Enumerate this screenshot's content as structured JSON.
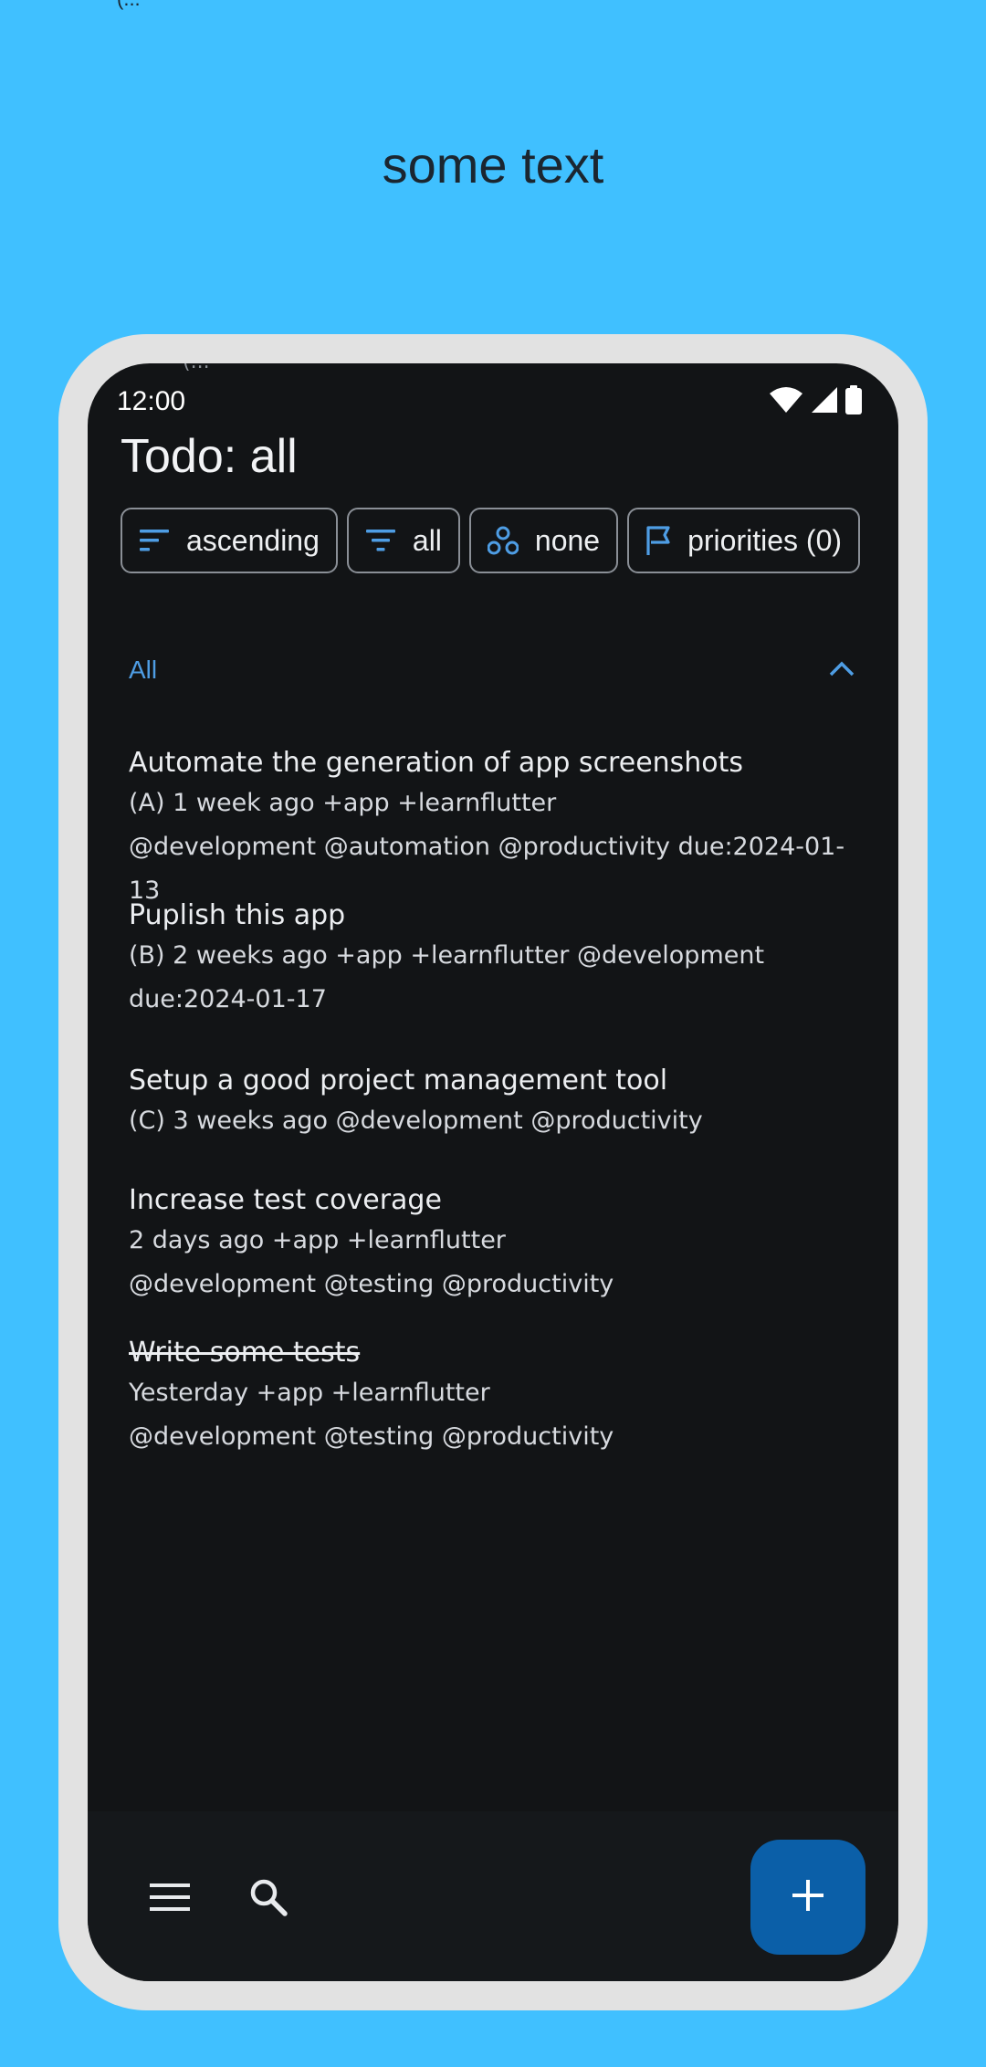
{
  "page": {
    "headline": "some text",
    "top_fragment": "(..."
  },
  "status_bar": {
    "time": "12:00",
    "icons": [
      "wifi-icon",
      "signal-icon",
      "battery-icon"
    ]
  },
  "app": {
    "title": "Todo: all",
    "chips": [
      {
        "icon": "sort-icon",
        "label": "ascending"
      },
      {
        "icon": "filter-icon",
        "label": "all"
      },
      {
        "icon": "group-icon",
        "label": "none"
      },
      {
        "icon": "flag-icon",
        "label": "priorities (0)"
      }
    ],
    "section": {
      "label": "All",
      "toggle_icon": "chevron-up-icon"
    },
    "todos": [
      {
        "title": "Automate the generation of app screenshots",
        "meta_lines": [
          "(A) 1 week ago +app +learnflutter",
          "@development @automation @productivity due:2024-01-13"
        ],
        "done": false
      },
      {
        "title": "Puplish this app",
        "meta_lines": [
          "(B) 2 weeks ago +app +learnflutter @development",
          "due:2024-01-17"
        ],
        "done": false
      },
      {
        "title": "Setup a good project management tool",
        "meta_lines": [
          "(C) 3 weeks ago @development @productivity"
        ],
        "done": false
      },
      {
        "title": "Increase test coverage",
        "meta_lines": [
          "2 days ago +app +learnflutter",
          "@development @testing @productivity"
        ],
        "done": false
      },
      {
        "title": "Write some tests",
        "meta_lines": [
          "Yesterday +app +learnflutter",
          "@development @testing @productivity"
        ],
        "done": true
      }
    ],
    "bottom_bar": {
      "menu_icon": "menu-icon",
      "search_icon": "search-icon",
      "fab_icon": "plus-icon"
    }
  },
  "colors": {
    "background": "#40c0ff",
    "frame": "#e2e2e2",
    "screen": "#121416",
    "accent": "#4e9de4",
    "fab": "#0b5fa8"
  }
}
